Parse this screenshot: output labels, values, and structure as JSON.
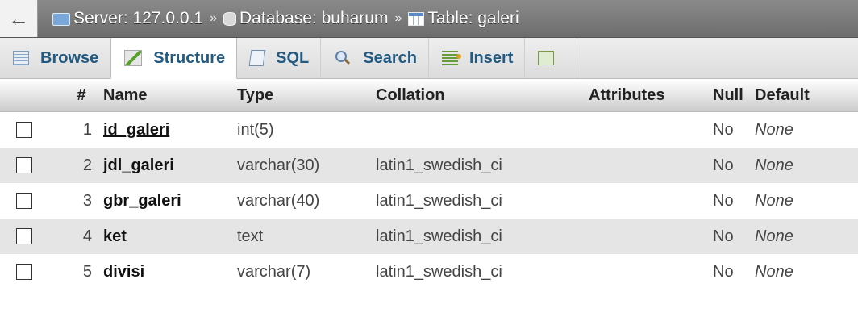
{
  "breadcrumb": {
    "back_symbol": "←",
    "server": "Server: 127.0.0.1",
    "database": "Database: buharum",
    "table": "Table: galeri",
    "separator": "»"
  },
  "tabs": [
    {
      "label": "Browse",
      "icon": "browse-icon"
    },
    {
      "label": "Structure",
      "icon": "structure-icon",
      "active": true
    },
    {
      "label": "SQL",
      "icon": "sql-icon"
    },
    {
      "label": "Search",
      "icon": "search-icon"
    },
    {
      "label": "Insert",
      "icon": "insert-icon"
    },
    {
      "label": "",
      "icon": "export-icon"
    }
  ],
  "table": {
    "headers": {
      "num": "#",
      "name": "Name",
      "type": "Type",
      "collation": "Collation",
      "attributes": "Attributes",
      "null": "Null",
      "default": "Default"
    },
    "rows": [
      {
        "num": "1",
        "name": "id_galeri",
        "type": "int(5)",
        "collation": "",
        "attributes": "",
        "null": "No",
        "default": "None",
        "primary": true
      },
      {
        "num": "2",
        "name": "jdl_galeri",
        "type": "varchar(30)",
        "collation": "latin1_swedish_ci",
        "attributes": "",
        "null": "No",
        "default": "None"
      },
      {
        "num": "3",
        "name": "gbr_galeri",
        "type": "varchar(40)",
        "collation": "latin1_swedish_ci",
        "attributes": "",
        "null": "No",
        "default": "None"
      },
      {
        "num": "4",
        "name": "ket",
        "type": "text",
        "collation": "latin1_swedish_ci",
        "attributes": "",
        "null": "No",
        "default": "None"
      },
      {
        "num": "5",
        "name": "divisi",
        "type": "varchar(7)",
        "collation": "latin1_swedish_ci",
        "attributes": "",
        "null": "No",
        "default": "None"
      }
    ]
  },
  "colors": {
    "tab_text": "#235a81",
    "breadcrumb_bg": "#7a7a7a",
    "row_even": "#e5e5e5"
  }
}
